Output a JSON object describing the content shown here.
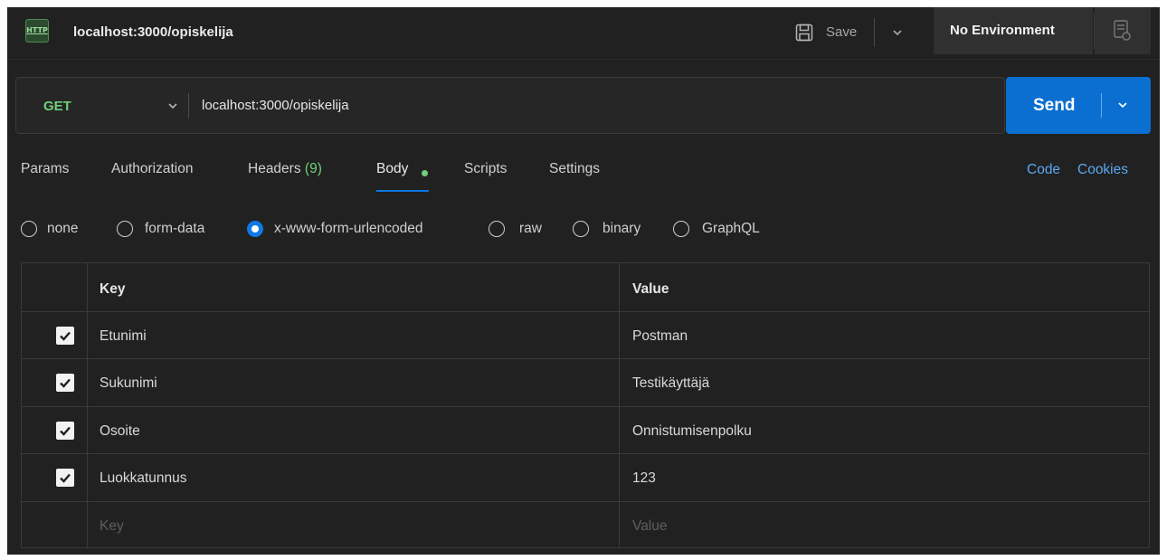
{
  "title_bar": {
    "http_icon_text": "HTTP",
    "request_name": "localhost:3000/opiskelija",
    "save_label": "Save",
    "environment": "No Environment"
  },
  "request": {
    "method": "GET",
    "url": "localhost:3000/opiskelija",
    "send_label": "Send"
  },
  "tabs": [
    {
      "label": "Params"
    },
    {
      "label": "Authorization"
    },
    {
      "label": "Headers",
      "count": "(9)"
    },
    {
      "label": "Body"
    },
    {
      "label": "Scripts"
    },
    {
      "label": "Settings"
    }
  ],
  "active_tab": "Body",
  "links": {
    "code": "Code",
    "cookies": "Cookies"
  },
  "body_types": [
    "none",
    "form-data",
    "x-www-form-urlencoded",
    "raw",
    "binary",
    "GraphQL"
  ],
  "selected_body_type": "x-www-form-urlencoded",
  "table": {
    "headers": {
      "key": "Key",
      "value": "Value"
    },
    "rows": [
      {
        "key": "Etunimi",
        "value": "Postman",
        "checked": true
      },
      {
        "key": "Sukunimi",
        "value": "Testikäyttäjä",
        "checked": true
      },
      {
        "key": "Osoite",
        "value": "Onnistumisenpolku",
        "checked": true
      },
      {
        "key": "Luokkatunnus",
        "value": "123",
        "checked": true
      }
    ],
    "placeholder": {
      "key": "Key",
      "value": "Value"
    }
  },
  "colors": {
    "background": "#212121",
    "accent": "#0a6fd1",
    "method_get": "#6fce79",
    "link": "#5aa8f0"
  },
  "icons": [
    "http-icon",
    "save-icon",
    "chevron-down-icon",
    "environment-quicklook-icon",
    "checkbox-checked-icon"
  ]
}
